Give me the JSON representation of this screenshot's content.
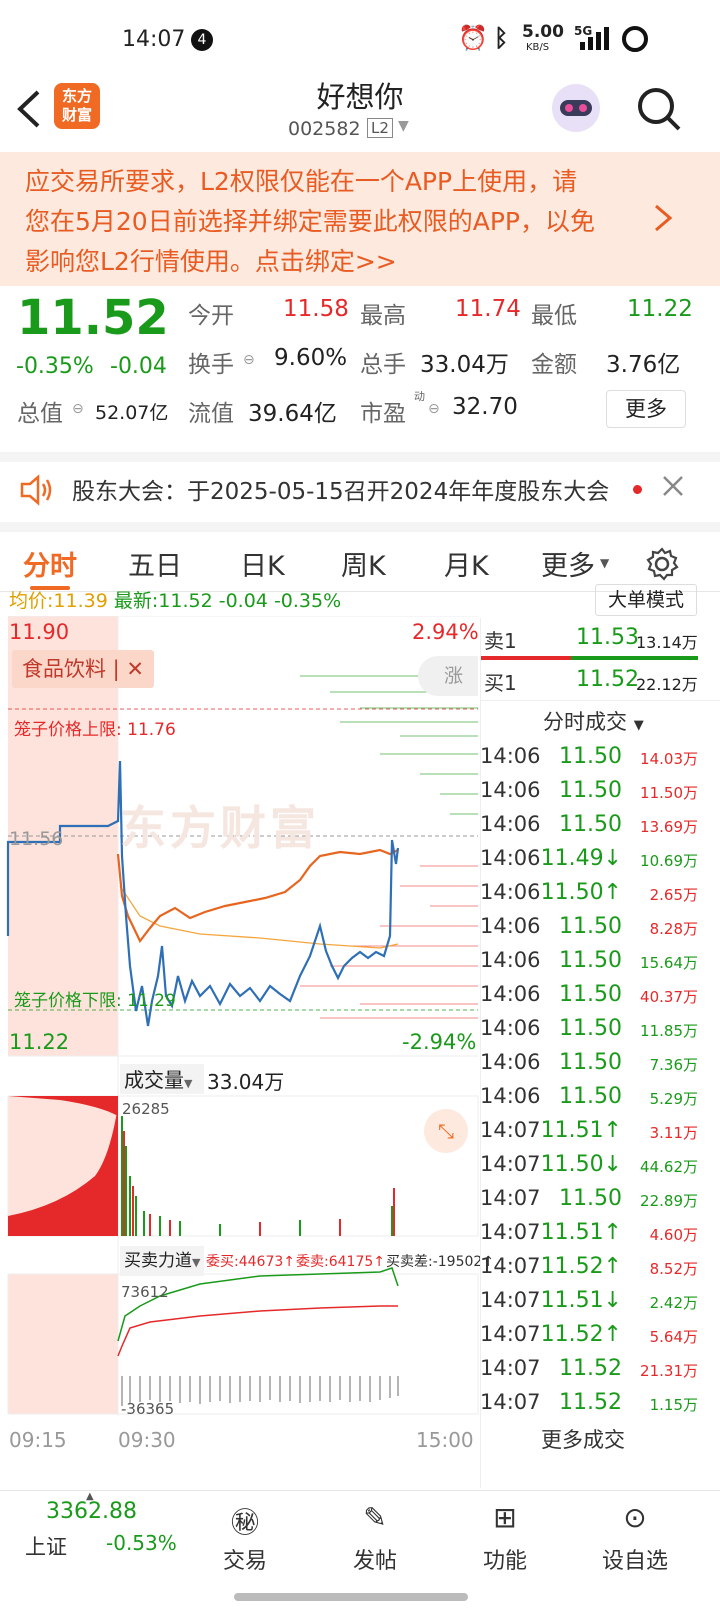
{
  "status_bar": {
    "time": "14:07",
    "notification_count": "4",
    "net_speed": "5.00",
    "net_unit": "KB/S",
    "signal": "5G"
  },
  "header": {
    "title": "好想你",
    "code": "002582",
    "level": "L2",
    "logo_text_1": "东方",
    "logo_text_2": "财富"
  },
  "banner": {
    "line1": "应交易所要求，L2权限仅能在一个APP上使用，请",
    "line2": "您在5月20日前选择并绑定需要此权限的APP，以免",
    "line3": "影响您L2行情使用。点击绑定>>"
  },
  "quote": {
    "price": "11.52",
    "change_pct": "-0.35%",
    "change": "-0.04",
    "open_label": "今开",
    "open": "11.58",
    "high_label": "最高",
    "high": "11.74",
    "low_label": "最低",
    "low": "11.22",
    "turnover_label": "换手",
    "turnover": "9.60%",
    "volume_label": "总手",
    "volume": "33.04万",
    "amount_label": "金额",
    "amount": "3.76亿",
    "mktcap_label": "总值",
    "mktcap": "52.07亿",
    "float_label": "流值",
    "float": "39.64亿",
    "pe_label": "市盈",
    "pe_sup": "动",
    "pe": "32.70",
    "more_label": "更多"
  },
  "notice": {
    "text": "股东大会：于2025-05-15召开2024年年度股东大会"
  },
  "tabs": [
    "分时",
    "五日",
    "日K",
    "周K",
    "月K",
    "更多"
  ],
  "chart": {
    "avg_label": "均价:",
    "avg": "11.39",
    "latest_label": "最新:",
    "latest": "11.52",
    "chg": "-0.04",
    "chg_pct": "-0.35%",
    "big_order_mode": "大单模式",
    "y_high": "11.90",
    "y_low": "11.22",
    "y_mid": "11.56",
    "pct_high": "2.94%",
    "pct_low": "-2.94%",
    "sector_tag": "食品饮料",
    "cage_upper": "笼子价格上限: 11.76",
    "cage_lower": "笼子价格下限: 11.29",
    "watermark": "东方财富",
    "limit_tab": "涨",
    "volume_label": "成交量",
    "volume_total": "33.04万",
    "volume_max": "26285",
    "force_label": "买卖力道",
    "force_buy": "委买:44673",
    "force_sell": "委卖:64175",
    "force_diff": "买卖差:-19502",
    "force_max": "73612",
    "force_min": "-36365",
    "time_start": "09:15",
    "time_open": "09:30",
    "time_end": "15:00"
  },
  "order_book": {
    "sell1_label": "卖1",
    "sell1_price": "11.53",
    "sell1_vol": "13.14万",
    "buy1_label": "买1",
    "buy1_price": "11.52",
    "buy1_vol": "22.12万",
    "ticks_label": "分时成交",
    "more_ticks": "更多成交",
    "ticks": [
      {
        "t": "14:06",
        "p": "11.50",
        "v": "14.03万",
        "c": "red"
      },
      {
        "t": "14:06",
        "p": "11.50",
        "v": "11.50万",
        "c": "red"
      },
      {
        "t": "14:06",
        "p": "11.50",
        "v": "13.69万",
        "c": "red"
      },
      {
        "t": "14:06",
        "p": "11.49↓",
        "v": "10.69万",
        "c": "green"
      },
      {
        "t": "14:06",
        "p": "11.50↑",
        "v": "2.65万",
        "c": "red"
      },
      {
        "t": "14:06",
        "p": "11.50",
        "v": "8.28万",
        "c": "red"
      },
      {
        "t": "14:06",
        "p": "11.50",
        "v": "15.64万",
        "c": "green"
      },
      {
        "t": "14:06",
        "p": "11.50",
        "v": "40.37万",
        "c": "red"
      },
      {
        "t": "14:06",
        "p": "11.50",
        "v": "11.85万",
        "c": "green"
      },
      {
        "t": "14:06",
        "p": "11.50",
        "v": "7.36万",
        "c": "green"
      },
      {
        "t": "14:06",
        "p": "11.50",
        "v": "5.29万",
        "c": "green"
      },
      {
        "t": "14:07",
        "p": "11.51↑",
        "v": "3.11万",
        "c": "red"
      },
      {
        "t": "14:07",
        "p": "11.50↓",
        "v": "44.62万",
        "c": "green"
      },
      {
        "t": "14:07",
        "p": "11.50",
        "v": "22.89万",
        "c": "green"
      },
      {
        "t": "14:07",
        "p": "11.51↑",
        "v": "4.60万",
        "c": "red"
      },
      {
        "t": "14:07",
        "p": "11.52↑",
        "v": "8.52万",
        "c": "red"
      },
      {
        "t": "14:07",
        "p": "11.51↓",
        "v": "2.42万",
        "c": "green"
      },
      {
        "t": "14:07",
        "p": "11.52↑",
        "v": "5.64万",
        "c": "red"
      },
      {
        "t": "14:07",
        "p": "11.52",
        "v": "21.31万",
        "c": "red"
      },
      {
        "t": "14:07",
        "p": "11.52",
        "v": "1.15万",
        "c": "green"
      }
    ]
  },
  "bottom_nav": {
    "index_value": "3362.88",
    "index_name": "上证",
    "index_chg": "-0.53%",
    "items": [
      "交易",
      "发帖",
      "功能",
      "设自选"
    ]
  },
  "colors": {
    "up": "#e5292a",
    "down": "#1a9a1a",
    "accent": "#f06a24"
  }
}
